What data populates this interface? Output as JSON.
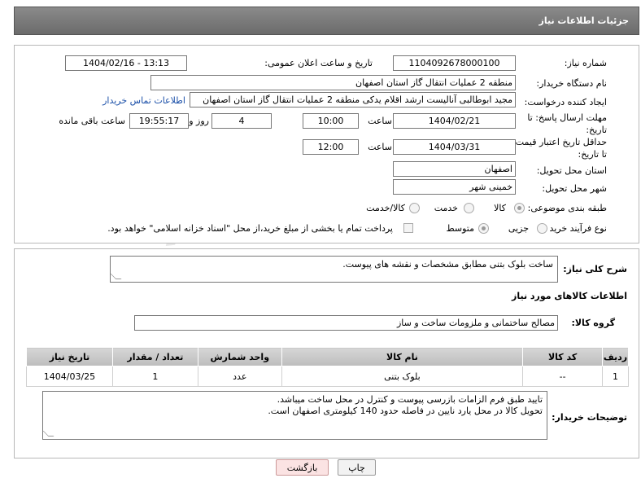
{
  "header": {
    "title": "جزئیات اطلاعات نیاز"
  },
  "form": {
    "need_number_label": "شماره نیاز:",
    "need_number": "1104092678000100",
    "announce_label": "تاریخ و ساعت اعلان عمومی:",
    "announce_value": "1404/02/16 - 13:13",
    "buyer_org_label": "نام دستگاه خریدار:",
    "buyer_org": "منطقه 2 عملیات انتقال گاز استان اصفهان",
    "creator_label": "ایجاد کننده درخواست:",
    "creator": "مجید ابوطالبی آنالیست ارشد اقلام یدکی منطقه 2 عملیات انتقال گاز استان اصفهان",
    "contact_link": "اطلاعات تماس خریدار",
    "reply_deadline_label": "مهلت ارسال پاسخ: تا تاریخ:",
    "reply_date": "1404/02/21",
    "time_label": "ساعت",
    "reply_time": "10:00",
    "days_value": "4",
    "days_label": "روز و",
    "remaining_time": "19:55:17",
    "remaining_label": "ساعت باقی مانده",
    "price_validity_label": "حداقل تاریخ اعتبار قیمت: تا تاریخ:",
    "price_date": "1404/03/31",
    "price_time": "12:00",
    "province_label": "استان محل تحویل:",
    "province": "اصفهان",
    "city_label": "شهر محل تحویل:",
    "city": "خمینی شهر",
    "category_label": "طبقه بندی موضوعی:",
    "category_options": [
      "کالا",
      "خدمت",
      "کالا/خدمت"
    ],
    "process_label": "نوع فرآیند خرید :",
    "process_options": [
      "جزیی",
      "متوسط"
    ],
    "payment_note": "پرداخت تمام یا بخشی از مبلغ خرید،از محل \"اسناد خزانه اسلامی\" خواهد بود."
  },
  "description": {
    "label": "شرح کلی نیاز:",
    "text": "ساخت بلوک بتنی مطابق مشخصات و نقشه های پیوست."
  },
  "goods": {
    "section_title": "اطلاعات کالاهای مورد نیاز",
    "group_label": "گروه کالا:",
    "group_value": "مصالح ساختمانی و ملزومات ساخت و ساز",
    "columns": [
      "ردیف",
      "کد کالا",
      "نام کالا",
      "واحد شمارش",
      "تعداد / مقدار",
      "تاریخ نیاز"
    ],
    "rows": [
      {
        "index": "1",
        "code": "--",
        "name": "بلوک بتنی",
        "unit": "عدد",
        "qty": "1",
        "date": "1404/03/25"
      }
    ]
  },
  "buyer_notes": {
    "label": "توضیحات خریدار:",
    "line1": "تایید طبق فرم الزامات بازرسی پیوست و کنترل در محل ساخت میباشد.",
    "line2": "تحویل کالا در محل یارد نایین در فاصله حدود 140 کیلومتری اصفهان است."
  },
  "buttons": {
    "print": "چاپ",
    "back": "بازگشت"
  },
  "watermark": "AriaTender.neT",
  "colors": {
    "header_bg": "#7a7a7a",
    "link": "#1a4fa8",
    "back_button_bg": "#fbe3e3"
  }
}
